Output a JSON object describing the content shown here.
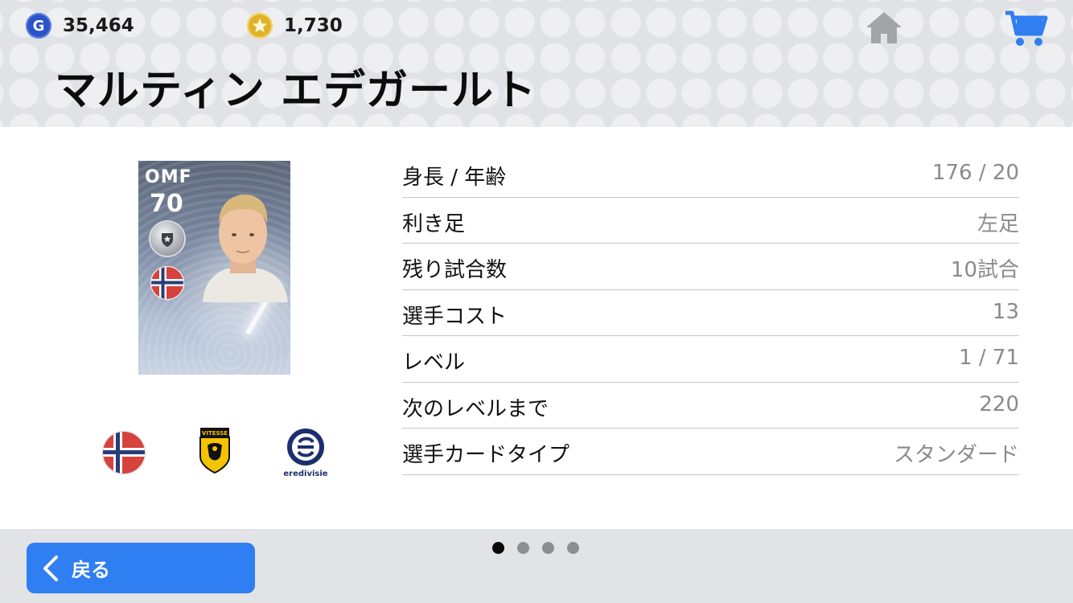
{
  "header": {
    "gp": {
      "icon": "gp-coin-icon",
      "icon_letter": "G",
      "value": "35,464"
    },
    "coins": {
      "icon": "star-coin-icon",
      "value": "1,730"
    },
    "player_name": "マルティン エデガールト"
  },
  "card": {
    "position": "OMF",
    "rating": "70",
    "nationality_flag": "norway-flag-icon"
  },
  "info": {
    "rows": [
      {
        "label": "身長 / 年齢",
        "value": "176 / 20"
      },
      {
        "label": "利き足",
        "value": "左足"
      },
      {
        "label": "残り試合数",
        "value": "10試合"
      },
      {
        "label": "選手コスト",
        "value": "13"
      },
      {
        "label": "レベル",
        "value": "1 / 71"
      },
      {
        "label": "次のレベルまで",
        "value": "220"
      },
      {
        "label": "選手カードタイプ",
        "value": "スタンダード"
      }
    ]
  },
  "badges": {
    "club_text": "VITESSE",
    "league_text": "eredivisie"
  },
  "footer": {
    "back_label": "戻る",
    "pager": {
      "total": 4,
      "active": 1
    }
  },
  "colors": {
    "accent_blue": "#2f7ef2",
    "gp_blue": "#2a52c9",
    "coin_gold": "#e0b22a",
    "header_bg": "#e1e2e5"
  }
}
